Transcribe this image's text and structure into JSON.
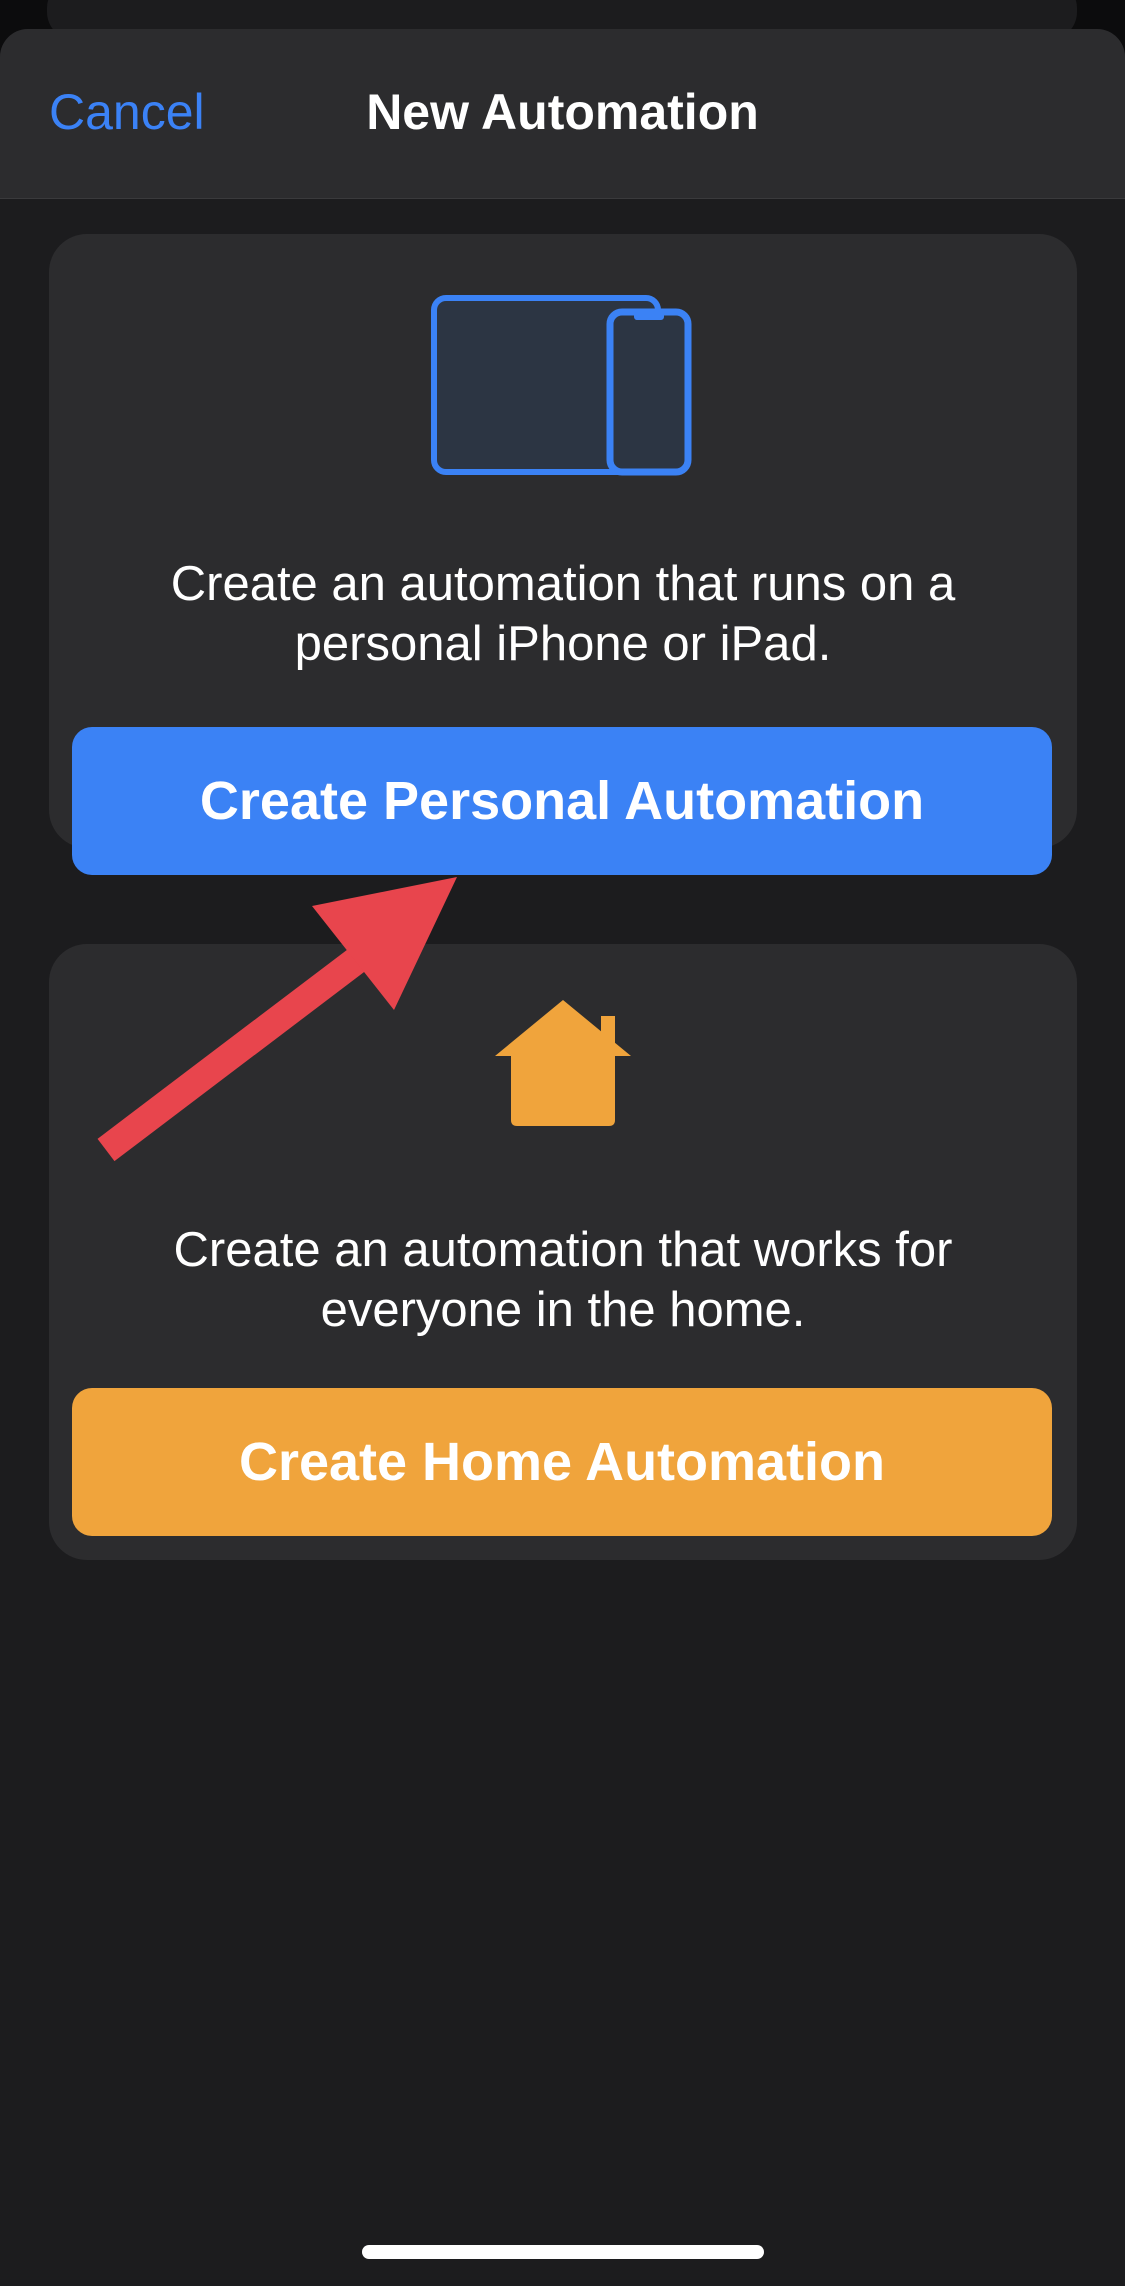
{
  "header": {
    "cancel_label": "Cancel",
    "title": "New Automation"
  },
  "personal": {
    "icon": "ipad-iphone-icon",
    "description_line1": "Create an automation that runs on a",
    "description_line2": "personal iPhone or iPad.",
    "button_label": "Create Personal Automation"
  },
  "home": {
    "icon": "house-icon",
    "description_line1": "Create an automation that works for",
    "description_line2": "everyone in the home.",
    "button_label": "Create Home Automation"
  },
  "colors": {
    "accent_blue": "#3b82f5",
    "accent_orange": "#f0a43c",
    "annotation_arrow": "#e8454d",
    "background": "#1c1c1e",
    "card": "#2c2c2e"
  }
}
